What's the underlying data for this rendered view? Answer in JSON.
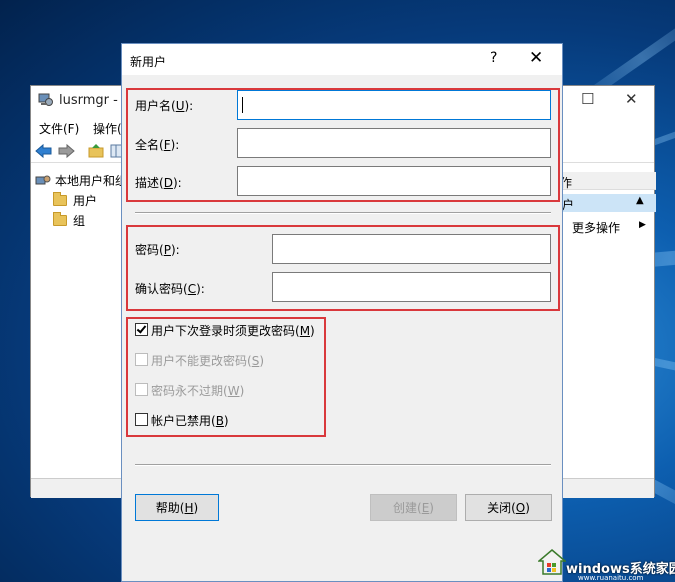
{
  "background_window": {
    "title": "lusrmgr - [",
    "menu": [
      "文件(F)",
      "操作("
    ],
    "tree": {
      "root": "本地用户和组",
      "items": [
        "用户",
        "组"
      ]
    },
    "right_panel": {
      "header": "作",
      "selected": "户",
      "more_actions": "更多操作"
    }
  },
  "dialog": {
    "title": "新用户",
    "help": "?",
    "close": "✕",
    "fields": {
      "username": {
        "label": "用户名(",
        "mn": "U",
        "end": "):",
        "value": ""
      },
      "fullname": {
        "label": "全名(",
        "mn": "F",
        "end": "):",
        "value": ""
      },
      "description": {
        "label": "描述(",
        "mn": "D",
        "end": "):",
        "value": ""
      },
      "password": {
        "label": "密码(",
        "mn": "P",
        "end": "):",
        "value": ""
      },
      "confirm": {
        "label": "确认密码(",
        "mn": "C",
        "end": "):",
        "value": ""
      }
    },
    "checkboxes": [
      {
        "label": "用户下次登录时须更改密码(",
        "mn": "M",
        "end": ")",
        "checked": true,
        "enabled": true
      },
      {
        "label": "用户不能更改密码(",
        "mn": "S",
        "end": ")",
        "checked": false,
        "enabled": false
      },
      {
        "label": "密码永不过期(",
        "mn": "W",
        "end": ")",
        "checked": false,
        "enabled": false
      },
      {
        "label": "帐户已禁用(",
        "mn": "B",
        "end": ")",
        "checked": false,
        "enabled": true
      }
    ],
    "buttons": {
      "help": {
        "label": "帮助(",
        "mn": "H",
        "end": ")"
      },
      "create": {
        "label": "创建(",
        "mn": "E",
        "end": ")"
      },
      "close": {
        "label": "关闭(",
        "mn": "O",
        "end": ")"
      }
    }
  },
  "watermark": {
    "brand": "windows系统家园",
    "domain": "www.ruanaitu.com"
  },
  "colors": {
    "annotation_red": "#d9383c",
    "focus_blue": "#0078d7"
  }
}
